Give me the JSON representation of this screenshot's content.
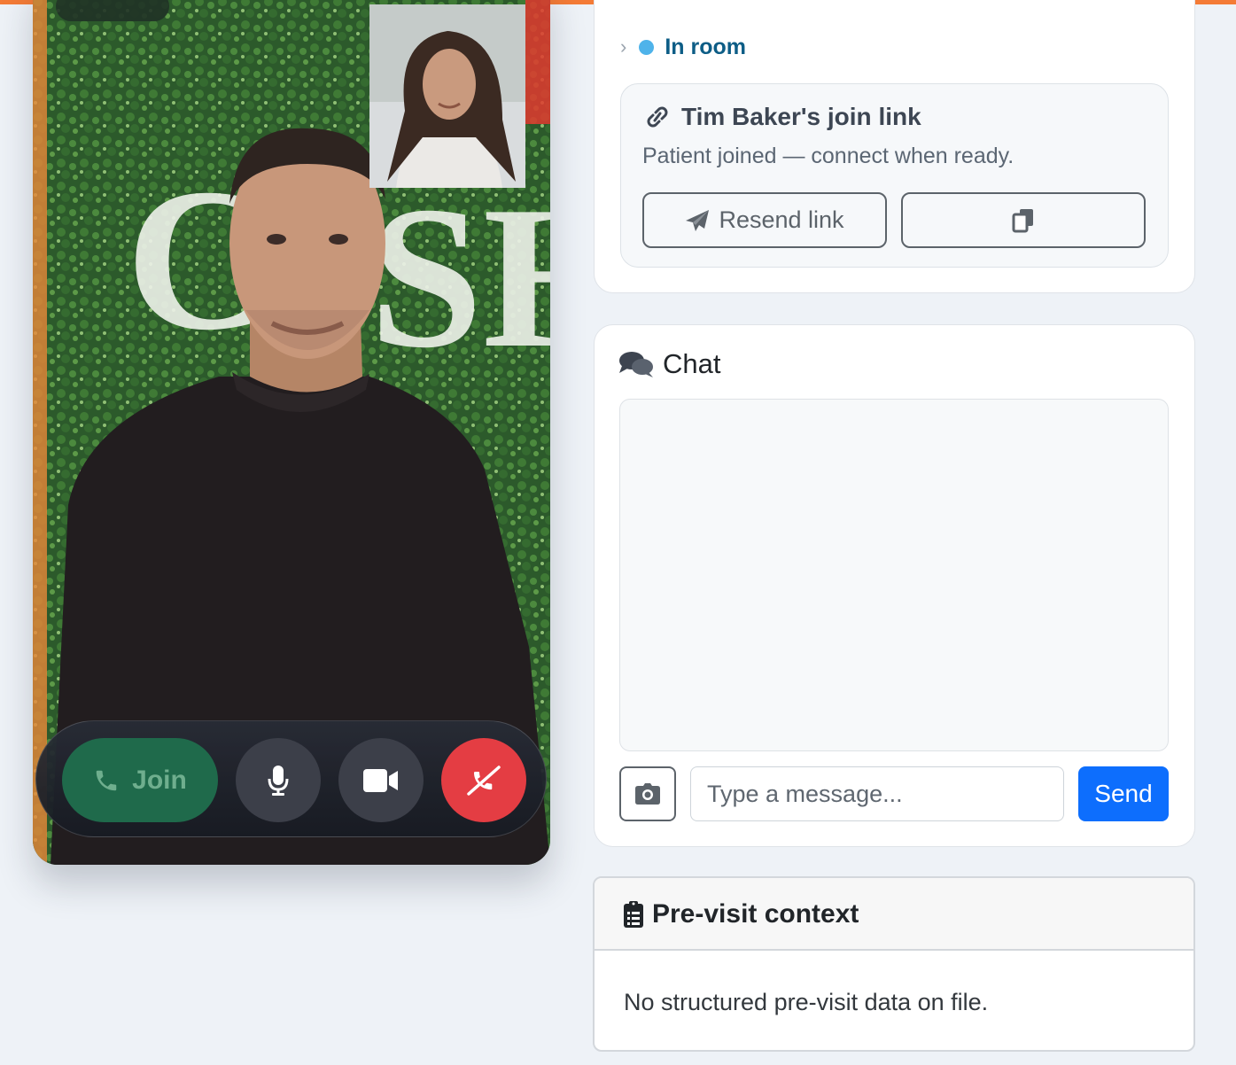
{
  "video": {
    "join_label": "Join",
    "controls": {
      "mic": "microphone-icon",
      "camera": "video-camera-icon",
      "end": "end-call-icon"
    }
  },
  "status": {
    "label": "In room",
    "dot_color": "#4fb3ea"
  },
  "join_link": {
    "title": "Tim Baker's join link",
    "subtitle": "Patient joined — connect when ready.",
    "resend_label": "Resend link",
    "copy_icon": "copy-icon"
  },
  "chat": {
    "title": "Chat",
    "input_placeholder": "Type a message...",
    "send_label": "Send",
    "camera_icon": "camera-icon"
  },
  "previsit": {
    "title": "Pre-visit context",
    "body": "No structured pre-visit data on file."
  },
  "colors": {
    "accent": "#f47b36",
    "primary": "#0d6efd",
    "join_green": "#1f6a4b",
    "end_red": "#e43d43"
  }
}
